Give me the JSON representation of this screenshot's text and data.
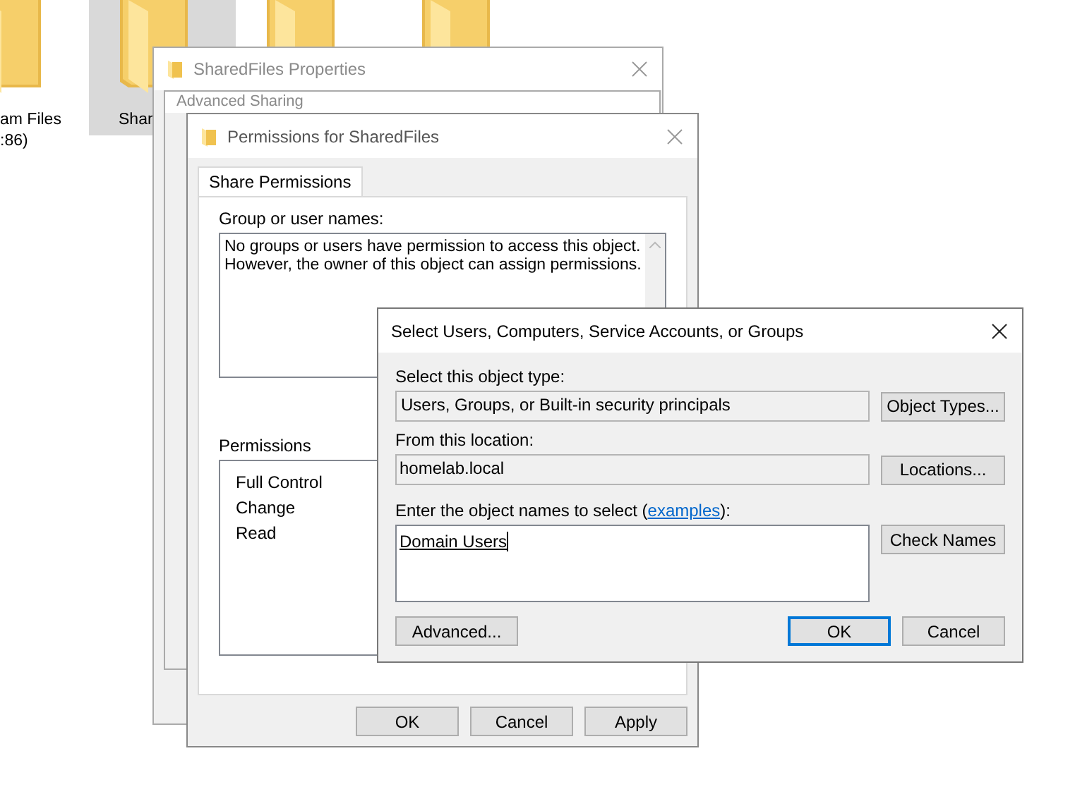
{
  "desktop": {
    "icons": [
      {
        "label_lines": [
          "am Files",
          ":86)"
        ],
        "selected": false
      },
      {
        "label_lines": [
          "Shar"
        ],
        "selected": true
      },
      {
        "selected": false
      },
      {
        "selected": false
      }
    ]
  },
  "properties_window": {
    "title": "SharedFiles Properties"
  },
  "advanced_sharing_window": {
    "title": "Advanced Sharing"
  },
  "permissions_window": {
    "title": "Permissions for SharedFiles",
    "tabs": [
      {
        "label": "Share Permissions",
        "selected": true
      }
    ],
    "group_label": "Group or user names:",
    "group_message_lines": [
      "No groups or users have permission to access this object.",
      "However, the owner of this object can assign permissions."
    ],
    "permissions_label": "Permissions",
    "permissions": [
      "Full Control",
      "Change",
      "Read"
    ],
    "buttons": [
      "OK",
      "Cancel",
      "Apply"
    ]
  },
  "select_dialog": {
    "title": "Select Users, Computers, Service Accounts, or Groups",
    "object_type_label": "Select this object type:",
    "object_type_value": "Users, Groups, or Built-in security principals",
    "object_types_button": "Object Types...",
    "location_label": "From this location:",
    "location_value": "homelab.local",
    "locations_button": "Locations...",
    "names_label_prefix": "Enter the object names to select (",
    "names_label_link": "examples",
    "names_label_suffix": "):",
    "names_value": "Domain Users",
    "check_names_button": "Check Names",
    "advanced_button": "Advanced...",
    "buttons": [
      {
        "label": "OK",
        "default": true
      },
      {
        "label": "Cancel",
        "default": false
      }
    ]
  }
}
